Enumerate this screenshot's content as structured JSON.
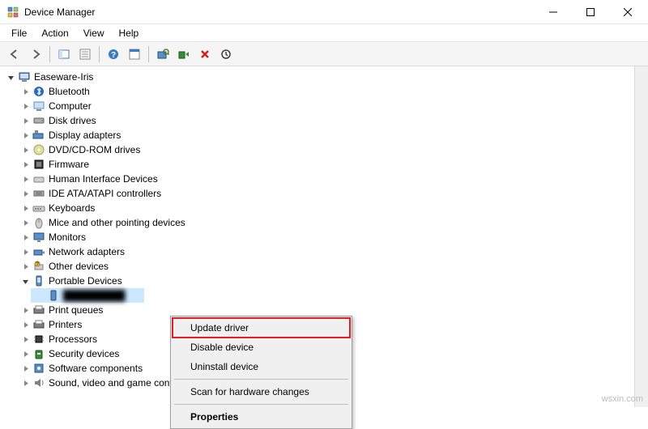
{
  "window": {
    "title": "Device Manager"
  },
  "menu": {
    "file": "File",
    "action": "Action",
    "view": "View",
    "help": "Help"
  },
  "tree": {
    "root": "Easeware-Iris",
    "items": [
      "Bluetooth",
      "Computer",
      "Disk drives",
      "Display adapters",
      "DVD/CD-ROM drives",
      "Firmware",
      "Human Interface Devices",
      "IDE ATA/ATAPI controllers",
      "Keyboards",
      "Mice and other pointing devices",
      "Monitors",
      "Network adapters",
      "Other devices",
      "Portable Devices",
      "Print queues",
      "Printers",
      "Processors",
      "Security devices",
      "Software components",
      "Sound, video and game controllers"
    ],
    "selected_device": "█████████"
  },
  "context_menu": {
    "update_driver": "Update driver",
    "disable_device": "Disable device",
    "uninstall_device": "Uninstall device",
    "scan": "Scan for hardware changes",
    "properties": "Properties"
  },
  "watermark": "wsxin.com"
}
